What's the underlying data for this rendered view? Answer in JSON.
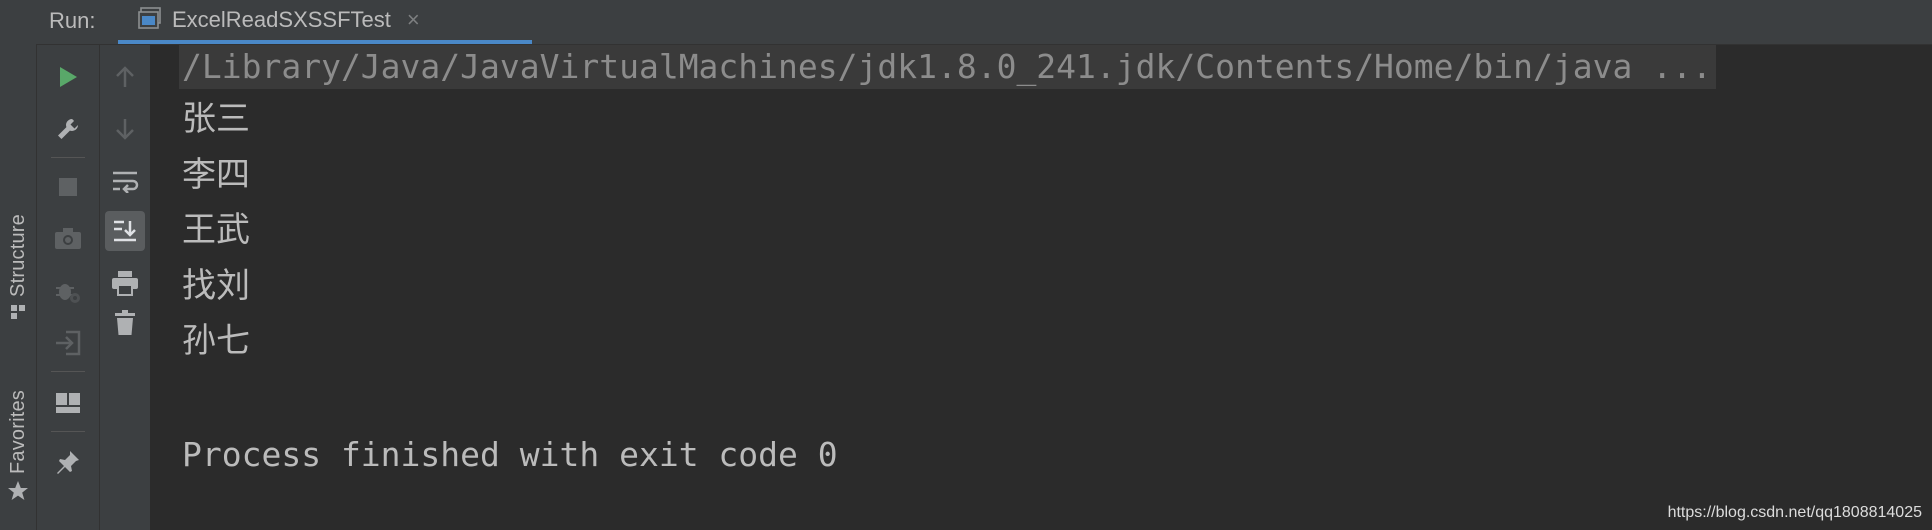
{
  "header": {
    "run_label": "Run:",
    "tab_title": "ExcelReadSXSSFTest",
    "close_symbol": "×"
  },
  "left_stripe": {
    "structure_label": "Structure",
    "favorites_label": "Favorites"
  },
  "toolbar_primary": [
    {
      "icon": "run-icon"
    },
    {
      "icon": "wrench-icon"
    },
    {
      "icon": "stop-icon"
    },
    {
      "icon": "camera-icon"
    },
    {
      "icon": "bug-settings-icon"
    },
    {
      "icon": "login-icon"
    },
    {
      "icon": "layout-icon"
    },
    {
      "icon": "pin-icon"
    }
  ],
  "toolbar_secondary": [
    {
      "icon": "arrow-up-icon"
    },
    {
      "icon": "arrow-down-icon"
    },
    {
      "icon": "soft-wrap-icon"
    },
    {
      "icon": "scroll-to-end-icon",
      "active": true
    },
    {
      "icon": "print-icon"
    },
    {
      "icon": "trash-icon"
    }
  ],
  "console": {
    "command": "/Library/Java/JavaVirtualMachines/jdk1.8.0_241.jdk/Contents/Home/bin/java ...",
    "output": [
      "张三",
      "李四",
      "王武",
      "找刘",
      "孙七"
    ],
    "exit_message": "Process finished with exit code 0"
  },
  "watermark": "https://blog.csdn.net/qq1808814025",
  "colors": {
    "background": "#2b2b2b",
    "panel": "#3c3f41",
    "accent": "#4a88c7",
    "run_green": "#59a869",
    "text": "#bbbbbb"
  }
}
